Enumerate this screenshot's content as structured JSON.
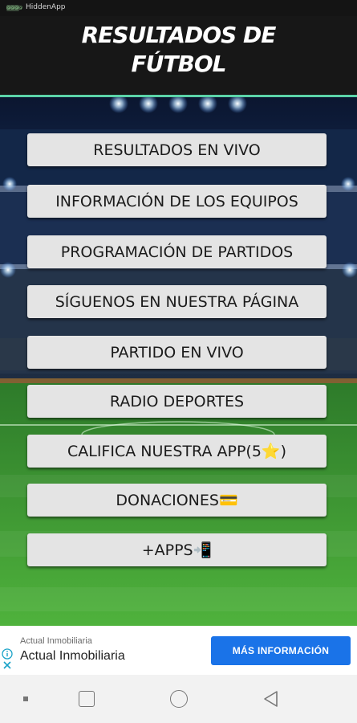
{
  "status_bar": {
    "chip_label": "@@@@",
    "app_name": "HiddenApp"
  },
  "header": {
    "title_line1": "RESULTADOS DE",
    "title_line2": "FÚTBOL"
  },
  "menu": [
    {
      "label": "RESULTADOS EN VIVO",
      "name": "resultados-en-vivo-button"
    },
    {
      "label": "INFORMACIÓN DE LOS EQUIPOS",
      "name": "informacion-equipos-button"
    },
    {
      "label": "PROGRAMACIÓN DE PARTIDOS",
      "name": "programacion-partidos-button"
    },
    {
      "label": "SÍGUENOS EN NUESTRA PÁGINA",
      "name": "siguenos-pagina-button"
    },
    {
      "label": "PARTIDO EN VIVO",
      "name": "partido-en-vivo-button"
    },
    {
      "label": "RADIO DEPORTES",
      "name": "radio-deportes-button"
    },
    {
      "label": "CALIFICA NUESTRA APP(5⭐)",
      "name": "califica-app-button"
    },
    {
      "label": "DONACIONES💳",
      "name": "donaciones-button"
    },
    {
      "label": "+APPS📲",
      "name": "more-apps-button"
    }
  ],
  "ad": {
    "advertiser_small": "Actual Inmobiliaria",
    "advertiser_name": "Actual Inmobiliaria",
    "cta_label": "MÁS INFORMACIÓN"
  },
  "colors": {
    "accent_line": "#5bd3a8",
    "cta_blue": "#1a73e8",
    "header_bg": "#171717",
    "button_bg": "#e4e4e4"
  },
  "icons": {
    "ad_info": "info-icon",
    "nav_recents": "recents-icon",
    "nav_home": "home-icon",
    "nav_back": "back-icon"
  }
}
